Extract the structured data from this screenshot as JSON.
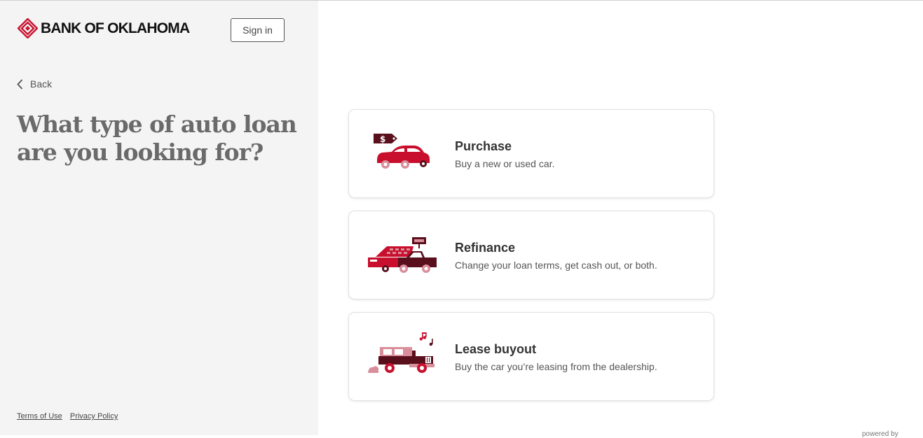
{
  "brand": {
    "name": "BANK OF OKLAHOMA",
    "color": "#c8102e"
  },
  "header": {
    "signin_label": "Sign in"
  },
  "nav": {
    "back_label": "Back"
  },
  "page": {
    "heading": "What type of auto loan are you looking for?"
  },
  "options": [
    {
      "title": "Purchase",
      "description": "Buy a new or used car.",
      "icon": "car-with-price-tag-icon"
    },
    {
      "title": "Refinance",
      "description": "Change your loan terms, get cash out, or both.",
      "icon": "truck-with-calculator-icon"
    },
    {
      "title": "Lease buyout",
      "description": "Buy the car you’re leasing from the dealership.",
      "icon": "jeep-with-music-notes-icon"
    }
  ],
  "footer": {
    "terms_label": "Terms of Use",
    "privacy_label": "Privacy Policy"
  },
  "powered_by": "powered by",
  "colors": {
    "sidebar_bg": "#f4f4f4",
    "accent": "#c8102e",
    "dark": "#5a0f1c",
    "pink": "#d98e9b"
  }
}
